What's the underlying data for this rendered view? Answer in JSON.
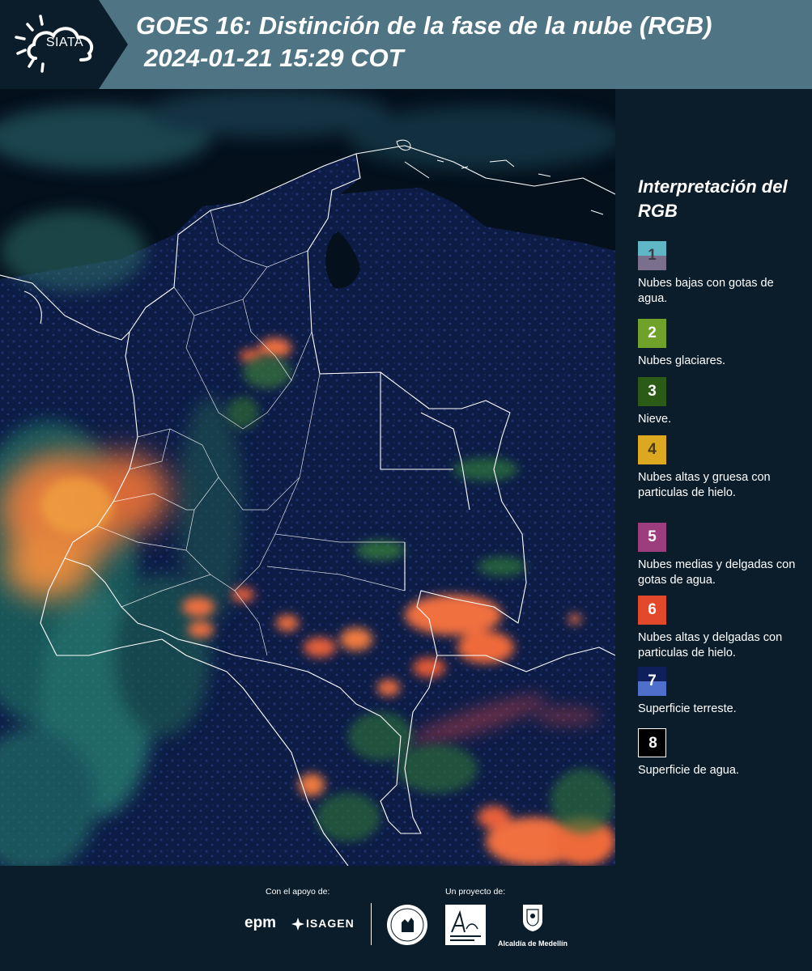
{
  "header": {
    "logo_text": "SIATA",
    "title_line1": "GOES 16: Distinción de la fase de la nube (RGB)",
    "title_line2": "2024-01-21 15:29 COT",
    "background_color": "#4f7585"
  },
  "map": {
    "description_icon": "satellite-rgb-map-colombia",
    "ocean_color": "#04101c",
    "land_color": "#0d1c45",
    "border_color": "#ffffff"
  },
  "legend": {
    "title": "Interpretación del RGB",
    "items": [
      {
        "number": "1",
        "label": "Nubes bajas con gotas de agua.",
        "color_top": "#5fb6c4",
        "color_bottom": "#7a708d",
        "number_color": "#3b3b4a"
      },
      {
        "number": "2",
        "label": "Nubes glaciares.",
        "color_top": "#6fa12b",
        "color_bottom": "#6fa12b",
        "number_color": "#ffffff"
      },
      {
        "number": "3",
        "label": "Nieve.",
        "color_top": "#2c5a17",
        "color_bottom": "#2c5a17",
        "number_color": "#ffffff"
      },
      {
        "number": "4",
        "label": "Nubes altas y gruesa con particulas de hielo.",
        "color_top": "#dba81f",
        "color_bottom": "#dba81f",
        "number_color": "#4a3a14"
      },
      {
        "number": "5",
        "label": "Nubes medias y delgadas con gotas de agua.",
        "color_top": "#9c3d7d",
        "color_bottom": "#9c3d7d",
        "number_color": "#ffffff"
      },
      {
        "number": "6",
        "label": "Nubes altas y delgadas con particulas de hielo.",
        "color_top": "#e2492a",
        "color_bottom": "#e2492a",
        "number_color": "#ffffff"
      },
      {
        "number": "7",
        "label": "Superficie terreste.",
        "color_top": "#0e1f5c",
        "color_bottom": "#4f6fcd",
        "number_color": "#ffffff"
      },
      {
        "number": "8",
        "label": "Superficie de agua.",
        "color_top": "#000000",
        "color_bottom": "#000000",
        "number_color": "#ffffff"
      }
    ]
  },
  "footer": {
    "support_caption": "Con el apoyo de:",
    "project_caption": "Un proyecto de:",
    "sponsor_1": "epm",
    "sponsor_2": "ISAGEN",
    "partner_3": "Alcaldía de Medellín"
  }
}
